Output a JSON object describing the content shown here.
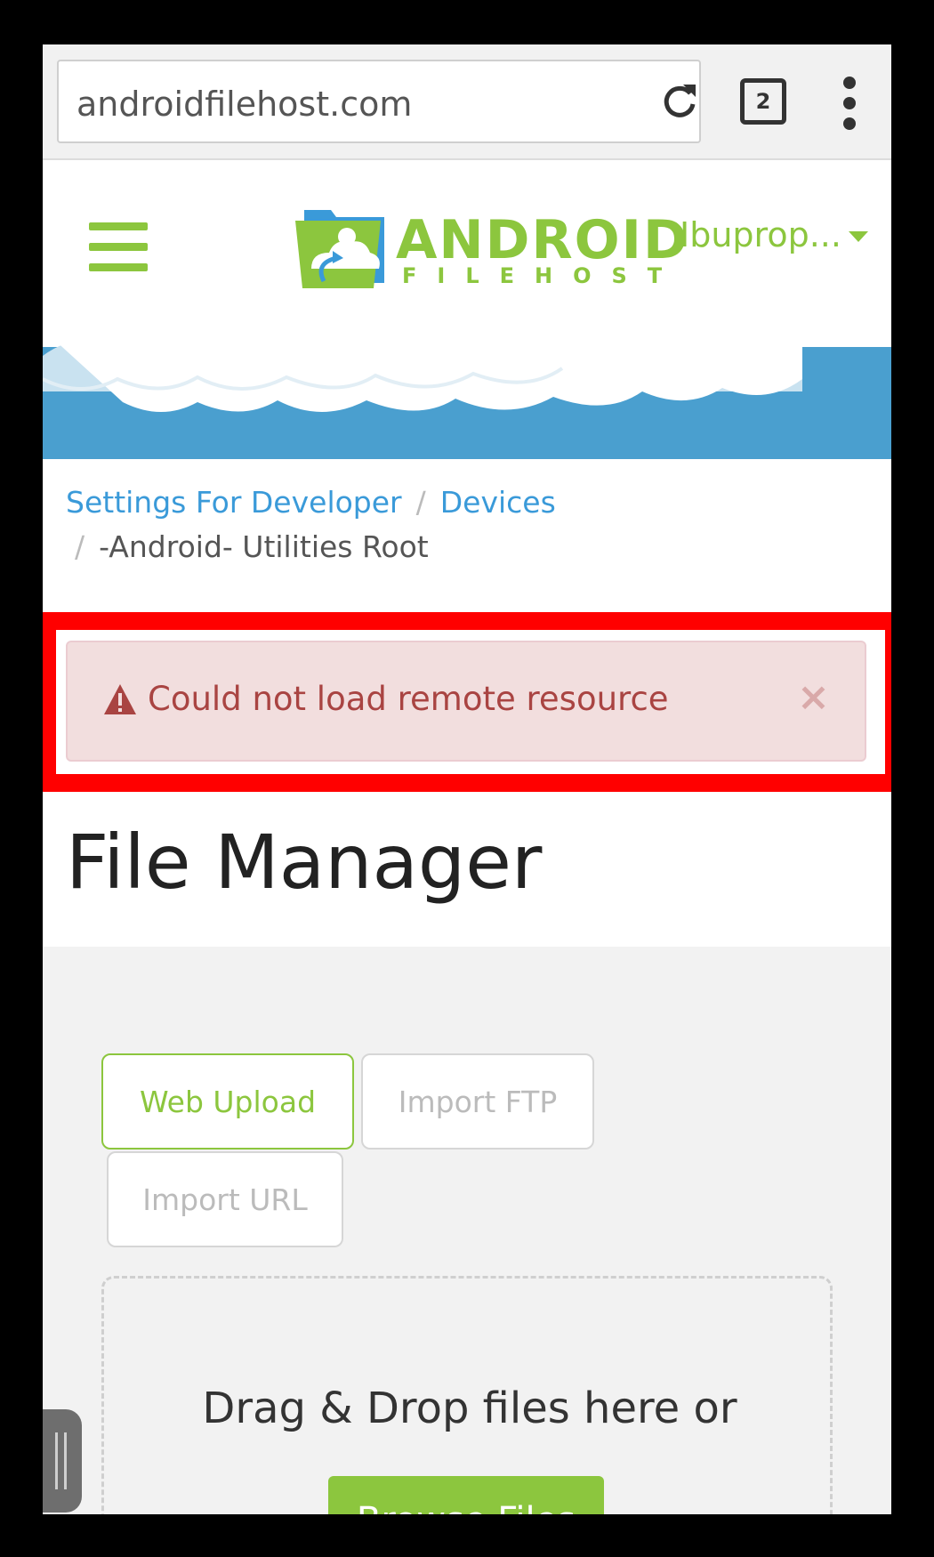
{
  "browser": {
    "url": "androidfilehost.com",
    "tab_count": "2"
  },
  "header": {
    "logo_word": "ANDROID",
    "logo_sub": "FILEHOST",
    "user": "Ibuprop..."
  },
  "breadcrumb": {
    "items": [
      "Settings For Developer",
      "Devices",
      "-Android- Utilities Root"
    ]
  },
  "alert": {
    "message": "Could not load remote resource",
    "close": "×"
  },
  "page": {
    "title": "File Manager"
  },
  "upload": {
    "tabs": [
      "Web Upload",
      "Import FTP",
      "Import URL"
    ],
    "drop_text": "Drag & Drop files here or",
    "browse_label": "Browse Files"
  },
  "colors": {
    "brand_green": "#8cc63e",
    "link_blue": "#3a9ad9",
    "alert_bg": "#f2dede",
    "alert_text": "#a94442",
    "highlight": "#ff0000"
  }
}
